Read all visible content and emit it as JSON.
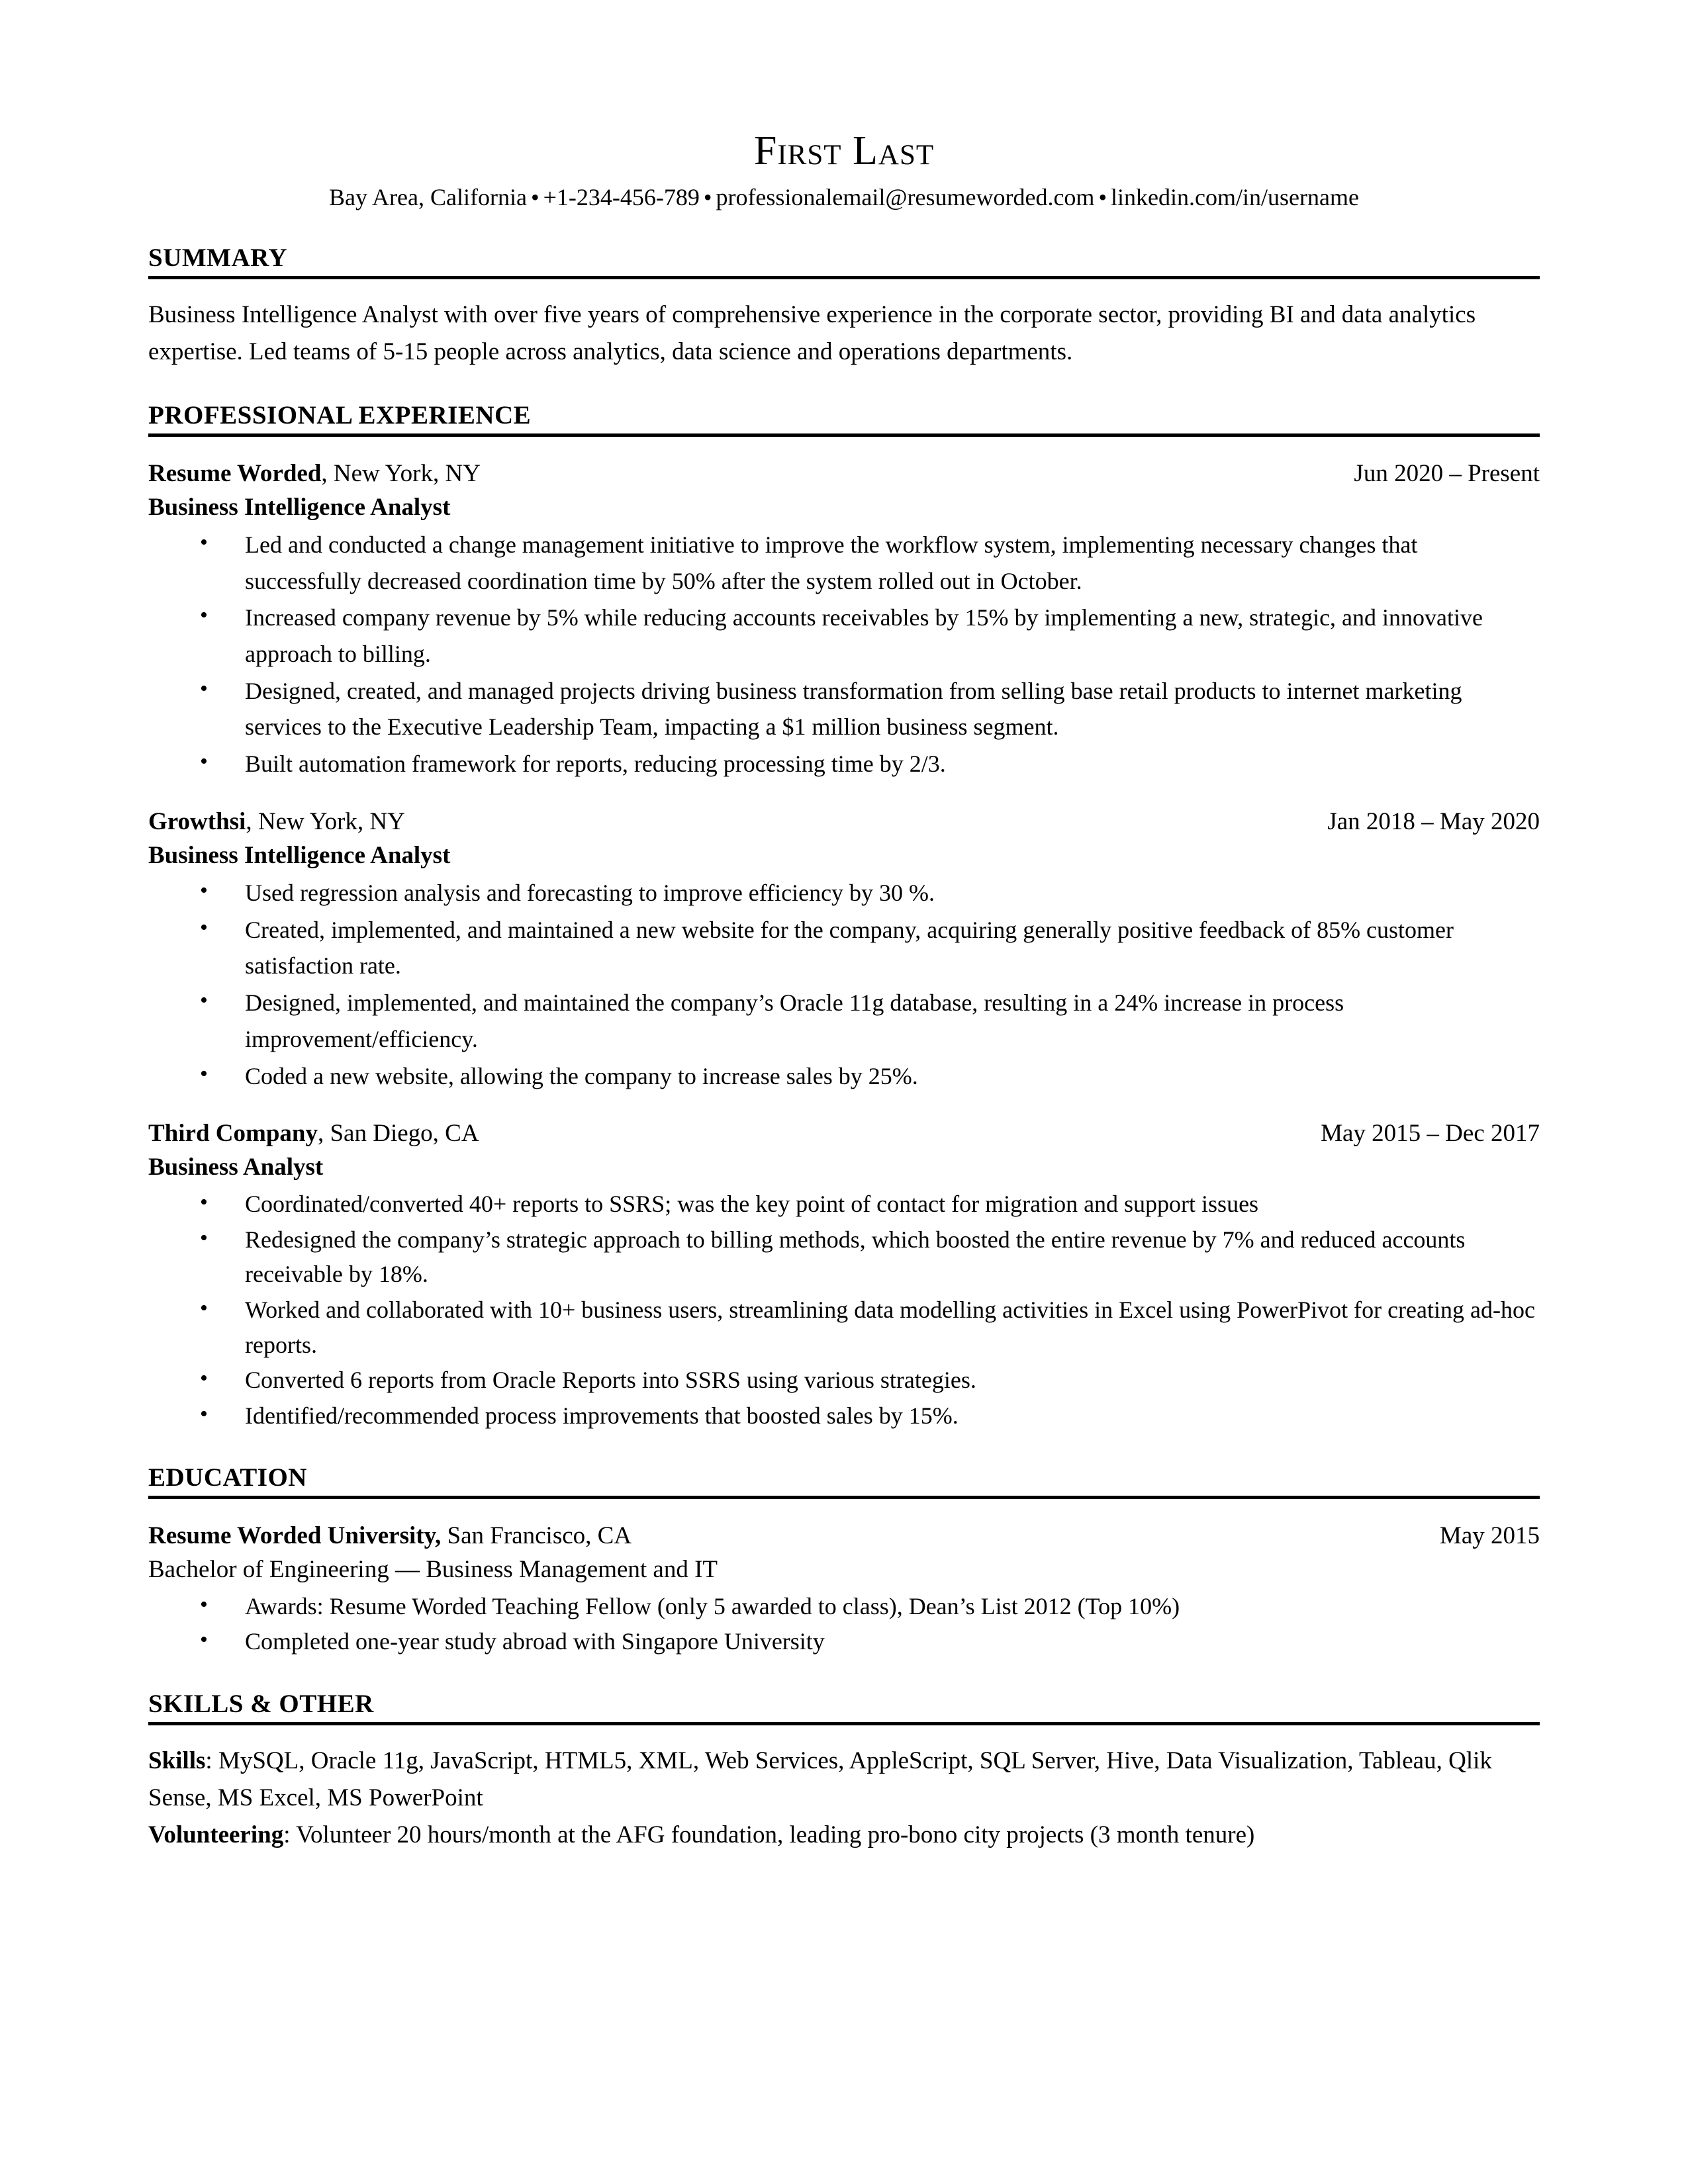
{
  "header": {
    "name": "First Last",
    "contact": {
      "location": "Bay Area, California",
      "phone": "+1-234-456-789",
      "email": "professionalemail@resumeworded.com",
      "linkedin": "linkedin.com/in/username",
      "separator": "•"
    }
  },
  "sections": {
    "summary": {
      "title": "SUMMARY",
      "text": "Business Intelligence Analyst with over five years of comprehensive experience in the corporate sector, providing BI and data analytics expertise. Led teams of 5-15 people across analytics, data science and operations departments."
    },
    "experience": {
      "title": "PROFESSIONAL EXPERIENCE",
      "jobs": [
        {
          "company": "Resume Worded",
          "location": ", New York, NY",
          "dates": "Jun 2020 – Present",
          "role": "Business Intelligence Analyst",
          "bullets": [
            "Led and conducted a change management initiative to improve the workflow system, implementing necessary changes that successfully decreased coordination time by 50% after the system rolled out in October.",
            "Increased company revenue by 5% while reducing accounts receivables by 15% by implementing a new, strategic, and innovative approach to billing.",
            "Designed, created, and managed projects driving business transformation from selling base retail products to internet marketing services to the Executive Leadership Team, impacting a $1 million business segment.",
            "Built automation framework for reports, reducing processing time by 2/3."
          ]
        },
        {
          "company": "Growthsi",
          "location": ", New York, NY",
          "dates": "Jan 2018 – May 2020",
          "role": "Business Intelligence Analyst",
          "bullets": [
            "Used regression analysis and forecasting to improve efficiency by 30 %.",
            "Created, implemented, and maintained a new website for the company, acquiring generally positive feedback of 85% customer satisfaction rate.",
            "Designed, implemented, and maintained the company’s Oracle 11g database, resulting in a 24% increase in process improvement/efficiency.",
            "Coded a new website, allowing the company to increase sales by 25%."
          ]
        },
        {
          "company": "Third Company",
          "location": ", San Diego, CA",
          "dates": "May 2015 – Dec 2017",
          "role": "Business Analyst",
          "bullets": [
            "Coordinated/converted 40+ reports to SSRS; was the key point of contact for migration and support issues",
            "Redesigned the company’s strategic approach to billing methods, which boosted the entire revenue by 7% and reduced accounts receivable by 18%.",
            "Worked and collaborated with 10+ business users, streamlining data modelling activities in Excel using PowerPivot for creating ad-hoc reports.",
            "Converted 6 reports from Oracle Reports into SSRS using various strategies.",
            "Identified/recommended process improvements that boosted sales by 15%."
          ]
        }
      ]
    },
    "education": {
      "title": "EDUCATION",
      "schools": [
        {
          "school": "Resume Worded University,",
          "location": " San Francisco, CA",
          "dates": "May 2015",
          "degree": "Bachelor of Engineering — Business Management and IT",
          "bullets": [
            "Awards: Resume Worded Teaching Fellow (only 5 awarded to class), Dean’s List 2012 (Top 10%)",
            "Completed one-year study abroad with Singapore University"
          ]
        }
      ]
    },
    "skills": {
      "title": "SKILLS & OTHER",
      "lines": [
        {
          "label": "Skills",
          "separator": ": ",
          "value": "MySQL, Oracle 11g, JavaScript, HTML5, XML, Web Services, AppleScript, SQL Server, Hive, Data Visualization, Tableau, Qlik Sense, MS Excel, MS PowerPoint"
        },
        {
          "label": "Volunteering",
          "separator": ": ",
          "value": "Volunteer 20 hours/month at the AFG foundation, leading pro-bono city projects (3 month tenure)"
        }
      ]
    }
  }
}
